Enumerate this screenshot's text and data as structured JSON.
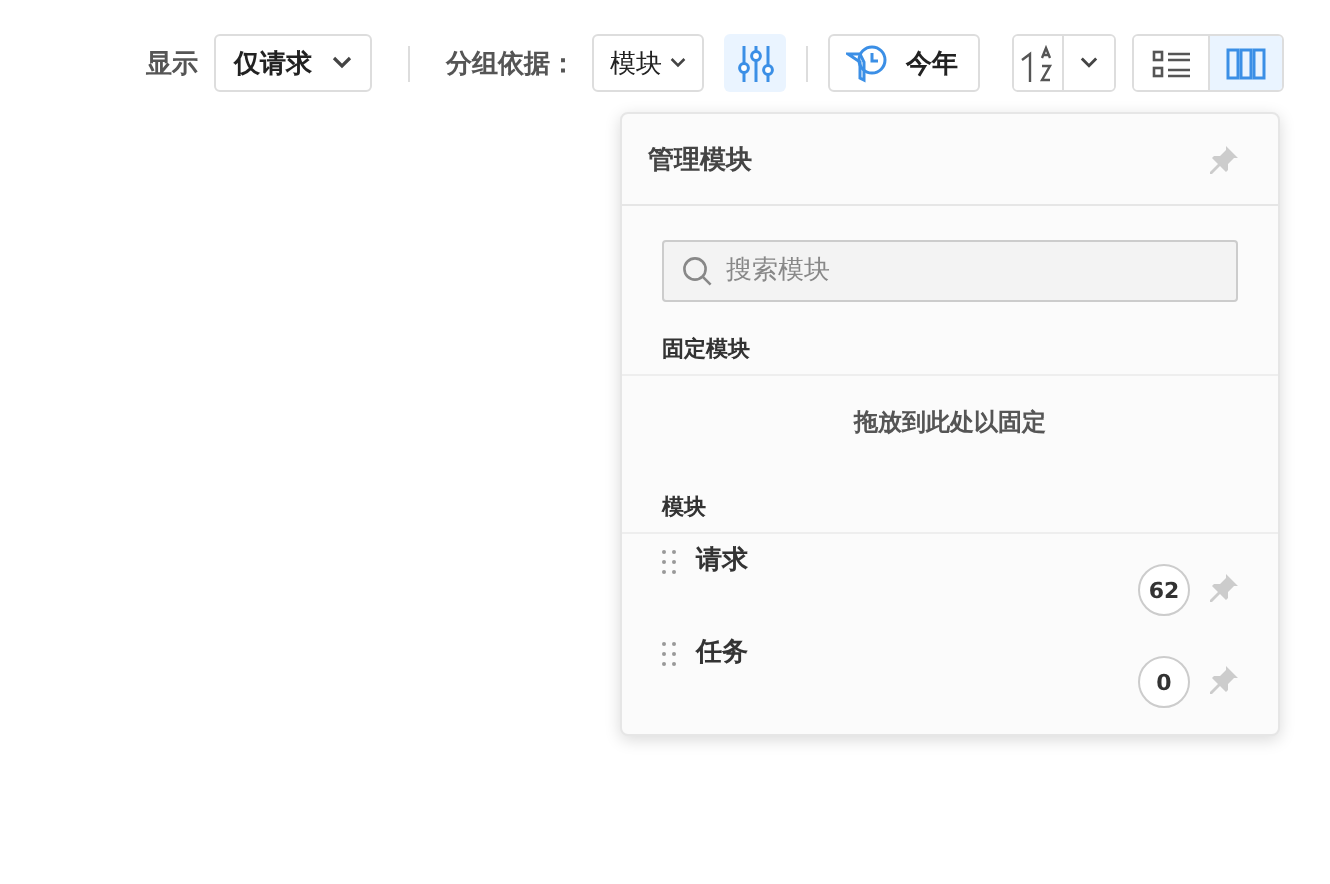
{
  "toolbar": {
    "show_label": "显示",
    "show_value": "仅请求",
    "group_label": "分组依据：",
    "group_value": "模块",
    "filter_active": true,
    "date_button": "今年",
    "views": [
      {
        "kind": "list",
        "selected": false
      },
      {
        "kind": "board",
        "selected": true
      }
    ]
  },
  "panel": {
    "title": "管理模块",
    "search": {
      "placeholder": "搜索模块"
    },
    "pinned_heading": "固定模块",
    "drop_hint": "拖放到此处以固定",
    "modules_heading": "模块",
    "modules": [
      {
        "name": "请求",
        "count": "62"
      },
      {
        "name": "任务",
        "count": "0"
      }
    ]
  }
}
